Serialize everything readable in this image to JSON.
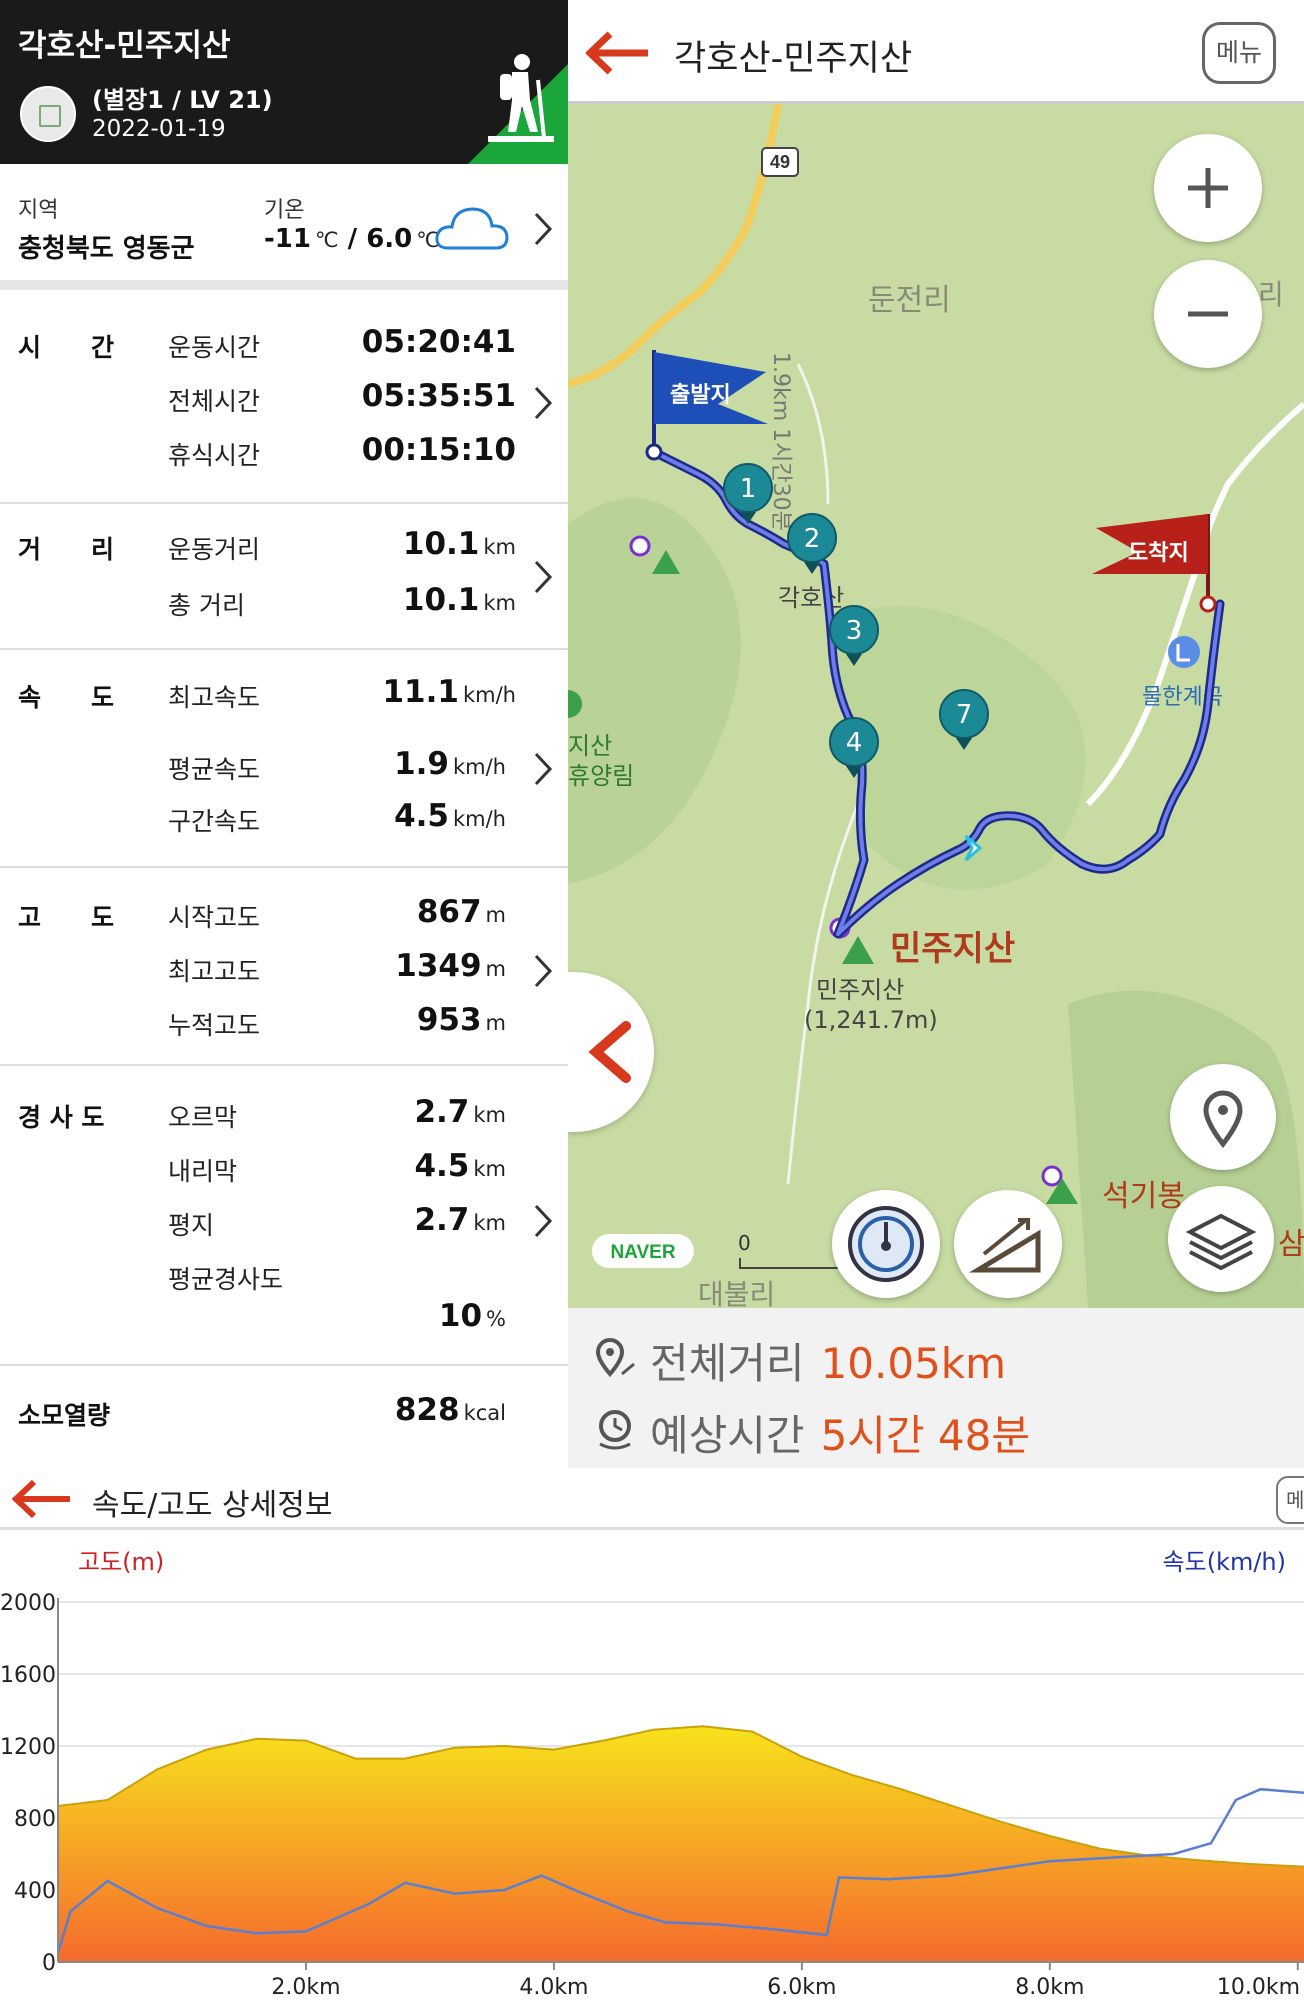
{
  "header": {
    "title": "각호산-민주지산",
    "rank": "(별장1 / LV 21)",
    "date": "2022-01-19"
  },
  "weather": {
    "region_label": "지역",
    "region_value": "충청북도 영동군",
    "temp_label": "기온",
    "temp_low": "-11",
    "temp_high": "6.0",
    "temp_unit": "℃",
    "temp_sep": " / ",
    "icon": "cloud-icon"
  },
  "stats": {
    "time": {
      "heading": "시　　간",
      "rows": [
        {
          "label": "운동시간",
          "value": "05:20:41"
        },
        {
          "label": "전체시간",
          "value": "05:35:51"
        },
        {
          "label": "휴식시간",
          "value": "00:15:10"
        }
      ]
    },
    "distance": {
      "heading": "거　　리",
      "rows": [
        {
          "label": "운동거리",
          "value": "10.1",
          "unit": "km"
        },
        {
          "label": "총 거리",
          "value": "10.1",
          "unit": "km"
        }
      ]
    },
    "speed": {
      "heading": "속　　도",
      "rows": [
        {
          "label": "최고속도",
          "value": "11.1",
          "unit": "km/h"
        },
        {
          "label": "평균속도",
          "value": "1.9",
          "unit": "km/h"
        },
        {
          "label": "구간속도",
          "value": "4.5",
          "unit": "km/h"
        }
      ]
    },
    "altitude": {
      "heading": "고　　도",
      "rows": [
        {
          "label": "시작고도",
          "value": "867",
          "unit": "m"
        },
        {
          "label": "최고고도",
          "value": "1349",
          "unit": "m"
        },
        {
          "label": "누적고도",
          "value": "953",
          "unit": "m"
        }
      ]
    },
    "slope": {
      "heading": "경 사 도",
      "rows": [
        {
          "label": "오르막",
          "value": "2.7",
          "unit": "km"
        },
        {
          "label": "내리막",
          "value": "4.5",
          "unit": "km"
        },
        {
          "label": "평지",
          "value": "2.7",
          "unit": "km"
        },
        {
          "label": "평균경사도",
          "value": "10",
          "unit": "%"
        }
      ]
    },
    "calories": {
      "label": "소모열량",
      "value": "828",
      "unit": "kcal"
    }
  },
  "map": {
    "title": "각호산-민주지산",
    "menu_label": "메뉴",
    "route_number": "49",
    "labels": {
      "village1": "둔전리",
      "village2": "리",
      "peak1": "각호산",
      "peak2": "민주지산",
      "peak2_small": "민주지산",
      "peak2_elev": "(1,241.7m)",
      "valley": "물한계곡",
      "forest1": "지산",
      "forest2": "휴양림",
      "peak3": "석기봉",
      "peak4": "삼",
      "bottom_village": "대불리",
      "trail_note": "1.9km 1시간30분",
      "scale_zero": "0",
      "brand": "NAVER"
    },
    "start_flag": "출발지",
    "end_flag": "도착지",
    "waypoints": [
      "1",
      "2",
      "3",
      "4",
      "7"
    ],
    "footer": {
      "distance_label": "전체거리",
      "distance_value": "10.05km",
      "time_label": "예상시간",
      "time_value": "5시간 48분"
    },
    "accent_color": "#e0501a",
    "route_color": "#3a4bc8",
    "waypoint_color": "#1c8a96"
  },
  "chart_panel": {
    "title": "속도/고도 상세정보",
    "menu_fragment": "메"
  },
  "chart_data": {
    "type": "area",
    "y_left_label": "고도(m)",
    "y_right_label": "속도(km/h)",
    "y_ticks": [
      "2000",
      "1600",
      "1200",
      "800",
      "400",
      "0"
    ],
    "ylim": [
      0,
      2000
    ],
    "x_ticks": [
      "2.0km",
      "4.0km",
      "6.0km",
      "8.0km",
      "10.0km"
    ],
    "xlim": [
      0,
      10.05
    ],
    "grid": true,
    "series": [
      {
        "name": "고도(m)",
        "x": [
          0,
          0.4,
          0.8,
          1.2,
          1.6,
          2.0,
          2.4,
          2.8,
          3.2,
          3.6,
          4.0,
          4.4,
          4.8,
          5.2,
          5.6,
          6.0,
          6.4,
          6.8,
          7.2,
          7.6,
          8.0,
          8.4,
          8.8,
          9.2,
          9.6,
          10.05
        ],
        "values": [
          867,
          900,
          1070,
          1180,
          1240,
          1230,
          1130,
          1130,
          1190,
          1200,
          1180,
          1230,
          1290,
          1310,
          1280,
          1140,
          1040,
          960,
          870,
          780,
          700,
          630,
          590,
          565,
          545,
          530
        ]
      },
      {
        "name": "속도(km/h)",
        "x": [
          0,
          0.1,
          0.4,
          0.8,
          1.2,
          1.6,
          2.0,
          2.5,
          2.8,
          3.2,
          3.6,
          3.9,
          4.2,
          4.6,
          4.9,
          5.3,
          5.8,
          6.2,
          6.3,
          6.7,
          7.2,
          7.6,
          8.0,
          8.5,
          9.0,
          9.3,
          9.5,
          9.7,
          10.05
        ],
        "values": [
          0.5,
          2.8,
          4.5,
          3.0,
          2.0,
          1.6,
          1.7,
          3.2,
          4.4,
          3.8,
          4.0,
          4.8,
          3.9,
          2.8,
          2.2,
          2.1,
          1.8,
          1.5,
          4.7,
          4.6,
          4.8,
          5.2,
          5.6,
          5.8,
          6.0,
          6.6,
          9.0,
          9.6,
          9.4
        ]
      }
    ],
    "colors": {
      "altitude_top": "#f7e31c",
      "altitude_bottom": "#f56a2d",
      "speed": "#5a7fd0",
      "left_axis": "#cc2222",
      "right_axis": "#2233aa"
    }
  }
}
